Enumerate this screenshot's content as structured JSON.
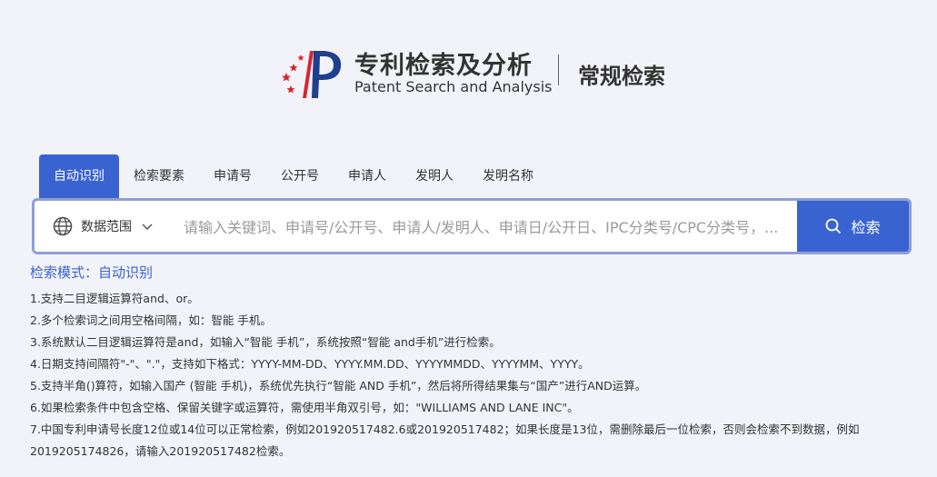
{
  "header": {
    "brand_cn": "专利检索及分析",
    "brand_en": "Patent Search and Analysis",
    "mode_title": "常规检索"
  },
  "tabs": [
    {
      "label": "自动识别",
      "active": true
    },
    {
      "label": "检索要素",
      "active": false
    },
    {
      "label": "申请号",
      "active": false
    },
    {
      "label": "公开号",
      "active": false
    },
    {
      "label": "申请人",
      "active": false
    },
    {
      "label": "发明人",
      "active": false
    },
    {
      "label": "发明名称",
      "active": false
    }
  ],
  "search": {
    "scope_label": "数据范围",
    "placeholder": "请输入关键词、申请号/公开号、申请人/发明人、申请日/公开日、IPC分类号/CPC分类号，...",
    "button_label": "检索"
  },
  "help": {
    "mode_label": "检索模式：自动识别",
    "lines": [
      "1.支持二目逻辑运算符and、or。",
      "2.多个检索词之间用空格间隔，如：智能 手机。",
      "3.系统默认二目逻辑运算符是and，如输入“智能 手机”，系统按照“智能 and手机”进行检索。",
      "4.日期支持间隔符\"-\"、\".\"，支持如下格式：YYYY-MM-DD、YYYY.MM.DD、YYYYMMDD、YYYYMM、YYYY。",
      "5.支持半角()算符，如输入国产 (智能 手机)，系统优先执行“智能 AND 手机”，然后将所得结果集与“国产”进行AND运算。",
      "6.如果检索条件中包含空格、保留关键字或运算符，需使用半角双引号，如：\"WILLIAMS AND LANE INC\"。",
      "7.中国专利申请号长度12位或14位可以正常检索，例如201920517482.6或201920517482；如果长度是13位，需删除最后一位检索，否则会检索不到数据，例如",
      "2019205174826，请输入201920517482检索。"
    ]
  },
  "colors": {
    "accent": "#3a63d2",
    "border": "#8f9fd4",
    "background": "#f2f3f8",
    "logo_red": "#d8252f"
  },
  "icons": {
    "logo": "patent-office-logo",
    "scope": "globe-icon",
    "scope_dropdown": "chevron-down-icon",
    "search": "search-icon"
  }
}
